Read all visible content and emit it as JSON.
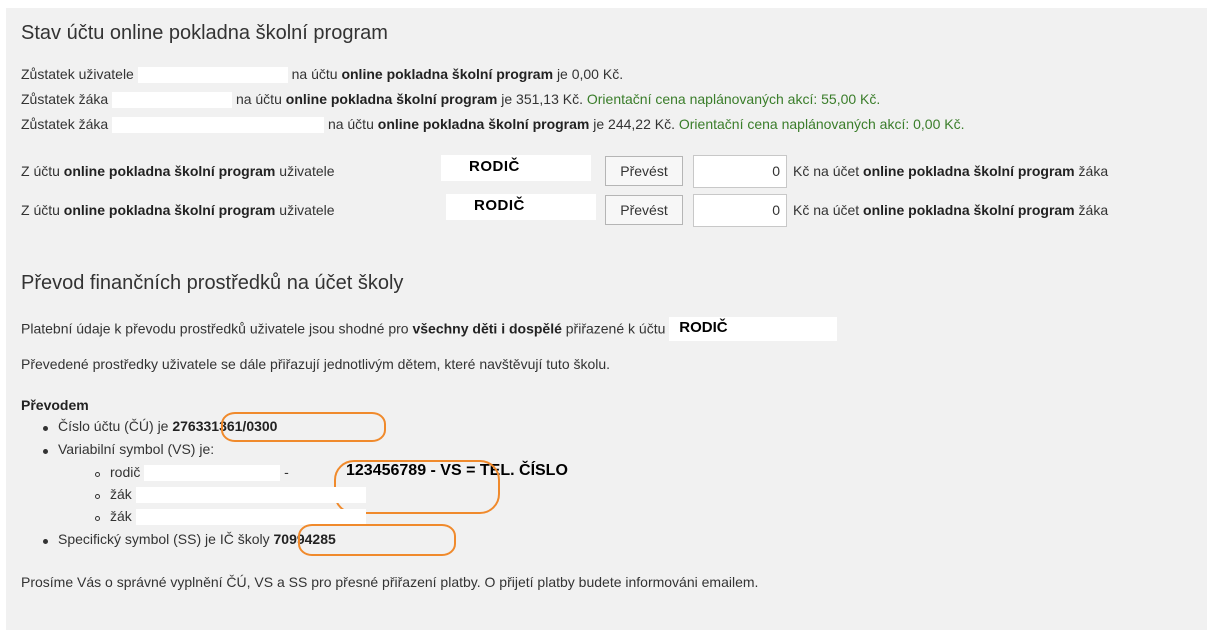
{
  "section1": {
    "title": "Stav účtu online pokladna školní program",
    "balance_lines": [
      {
        "prefix": "Zůstatek uživatele",
        "mid": "na účtu",
        "account": "online pokladna školní program",
        "suffix": "je 0,00 Kč."
      },
      {
        "prefix": "Zůstatek žáka",
        "mid": "na účtu",
        "account": "online pokladna školní program",
        "suffix": "je 351,13 Kč.",
        "note": "Orientační cena naplánovaných akcí: 55,00 Kč."
      },
      {
        "prefix": "Zůstatek žáka",
        "mid": "na účtu",
        "account": "online pokladna školní program",
        "suffix": "je 244,22 Kč.",
        "note": "Orientační cena naplánovaných akcí: 0,00 Kč."
      }
    ],
    "transfer_rows": [
      {
        "from_prefix": "Z účtu",
        "account": "online pokladna školní program",
        "user_word": "uživatele",
        "parent": "RODIČ",
        "button": "Převést",
        "amount": "0",
        "to_text": "Kč na účet",
        "to_account": "online pokladna školní program",
        "to_suffix": "žáka"
      },
      {
        "from_prefix": "Z účtu",
        "account": "online pokladna školní program",
        "user_word": "uživatele",
        "parent": "RODIČ",
        "button": "Převést",
        "amount": "0",
        "to_text": "Kč na účet",
        "to_account": "online pokladna školní program",
        "to_suffix": "žáka"
      }
    ]
  },
  "section2": {
    "title": "Převod finančních prostředků na účet školy",
    "info1_prefix": "Platební údaje k převodu prostředků uživatele jsou shodné pro",
    "info1_bold": "všechny děti i dospělé",
    "info1_suffix": "přiřazené k účtu",
    "info1_parent": "RODIČ",
    "info2": "Převedené prostředky uživatele se dále přiřazují jednotlivým dětem, které navštěvují tuto školu.",
    "by_transfer": "Převodem",
    "account_label": "Číslo účtu (ČÚ) je",
    "account_number": "276331361/0300",
    "vs_label": "Variabilní symbol (VS) je:",
    "vs_items": [
      {
        "label": "rodič",
        "sep": "-",
        "value": "123456789 - VS",
        "extra": "= TEL. ČÍSLO"
      },
      {
        "label": "žák"
      },
      {
        "label": "žák"
      }
    ],
    "ss_label": "Specifický symbol (SS) je IČ školy",
    "ss_value": "70994285",
    "footer": "Prosíme Vás o správné vyplnění ČÚ, VS a SS pro přesné přiřazení platby. O přijetí platby budete informováni emailem."
  },
  "colors": {
    "panel": "#f1f1f1",
    "note_green": "#3a7d2a",
    "highlight": "#f08a2c"
  }
}
